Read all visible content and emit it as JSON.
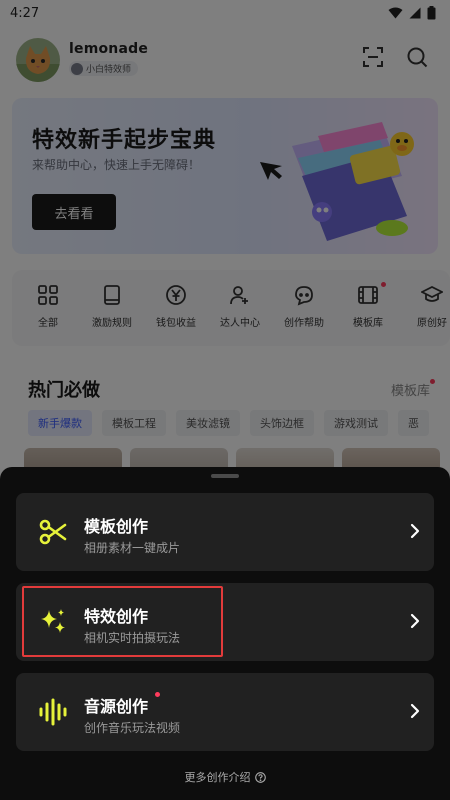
{
  "status": {
    "time": "4:27"
  },
  "profile": {
    "username": "lemonade",
    "badge": "小白特效师"
  },
  "banner": {
    "title": "特效新手起步宝典",
    "subtitle": "来帮助中心，快速上手无障碍！",
    "button": "去看看"
  },
  "quick_links": [
    {
      "label": "全部",
      "icon": "grid-icon"
    },
    {
      "label": "激励规则",
      "icon": "book-icon"
    },
    {
      "label": "钱包收益",
      "icon": "yuan-icon"
    },
    {
      "label": "达人中心",
      "icon": "person-add-icon"
    },
    {
      "label": "创作帮助",
      "icon": "chat-help-icon"
    },
    {
      "label": "模板库",
      "icon": "film-icon"
    },
    {
      "label": "原创好",
      "icon": "cap-icon"
    }
  ],
  "hot": {
    "title": "热门必做",
    "library_link": "模板库",
    "chips": [
      "新手爆款",
      "模板工程",
      "美妆滤镜",
      "头饰边框",
      "游戏测试",
      "恶"
    ]
  },
  "sheet": {
    "options": [
      {
        "title": "模板创作",
        "subtitle": "相册素材一键成片",
        "icon": "scissors-icon"
      },
      {
        "title": "特效创作",
        "subtitle": "相机实时拍摄玩法",
        "icon": "sparkle-icon"
      },
      {
        "title": "音源创作",
        "subtitle": "创作音乐玩法视频",
        "icon": "audio-wave-icon"
      }
    ],
    "more_link": "更多创作介绍",
    "accent_color": "#e6f23a"
  }
}
